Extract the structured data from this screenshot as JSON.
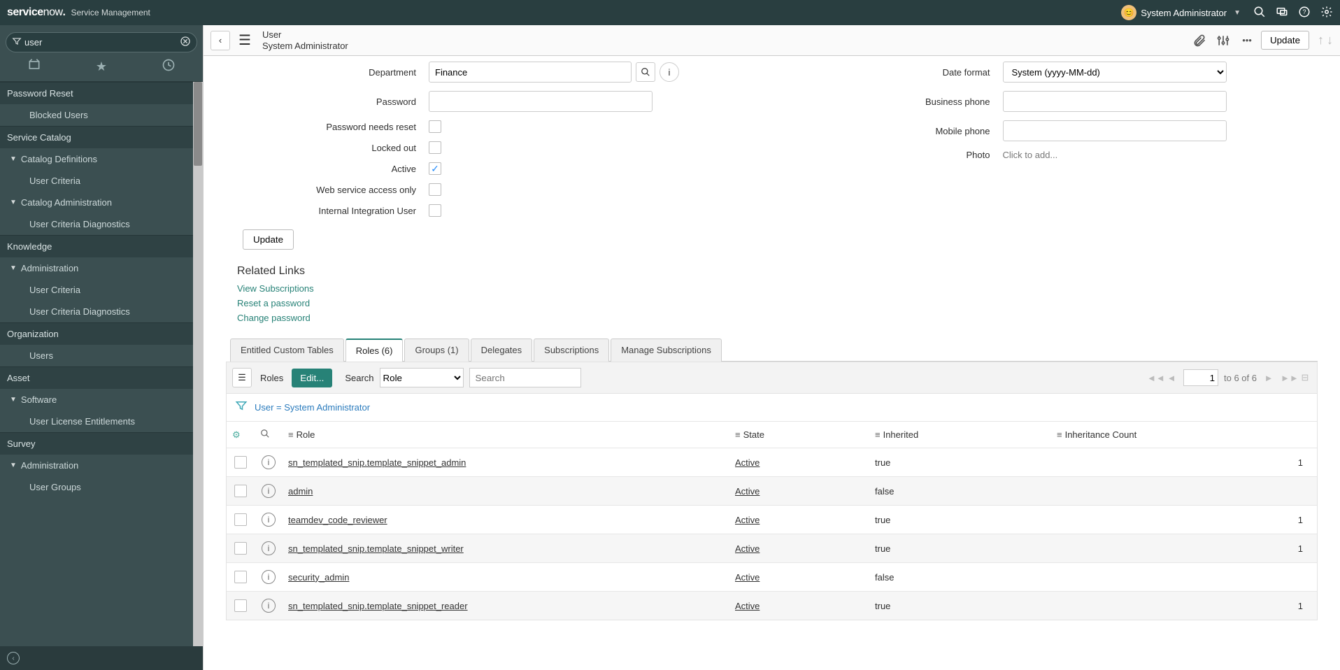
{
  "banner": {
    "logo_main": "service",
    "logo_suffix": "now",
    "product": "Service Management",
    "user_name": "System Administrator",
    "avatar_initials": "😊"
  },
  "nav": {
    "filter_value": "user",
    "sections": [
      {
        "type": "section",
        "label": "Password Reset"
      },
      {
        "type": "sub2",
        "label": "Blocked Users"
      },
      {
        "type": "section",
        "label": "Service Catalog"
      },
      {
        "type": "sub",
        "label": "Catalog Definitions",
        "tri": true
      },
      {
        "type": "sub2",
        "label": "User Criteria"
      },
      {
        "type": "sub",
        "label": "Catalog Administration",
        "tri": true
      },
      {
        "type": "sub2",
        "label": "User Criteria Diagnostics"
      },
      {
        "type": "section",
        "label": "Knowledge"
      },
      {
        "type": "sub",
        "label": "Administration",
        "tri": true
      },
      {
        "type": "sub2",
        "label": "User Criteria"
      },
      {
        "type": "sub2",
        "label": "User Criteria Diagnostics"
      },
      {
        "type": "section",
        "label": "Organization"
      },
      {
        "type": "sub2",
        "label": "Users"
      },
      {
        "type": "section",
        "label": "Asset"
      },
      {
        "type": "sub",
        "label": "Software",
        "tri": true
      },
      {
        "type": "sub2",
        "label": "User License Entitlements"
      },
      {
        "type": "section",
        "label": "Survey"
      },
      {
        "type": "sub",
        "label": "Administration",
        "tri": true
      },
      {
        "type": "sub2",
        "label": "User Groups"
      }
    ]
  },
  "header": {
    "title": "User",
    "subtitle": "System Administrator",
    "update_label": "Update"
  },
  "form": {
    "left": {
      "department_label": "Department",
      "department_value": "Finance",
      "password_label": "Password",
      "needs_reset_label": "Password needs reset",
      "locked_out_label": "Locked out",
      "active_label": "Active",
      "active_checked": "✓",
      "web_access_label": "Web service access only",
      "internal_label": "Internal Integration User"
    },
    "right": {
      "date_format_label": "Date format",
      "date_format_value": "System (yyyy-MM-dd)",
      "business_phone_label": "Business phone",
      "mobile_phone_label": "Mobile phone",
      "photo_label": "Photo",
      "photo_value": "Click to add..."
    },
    "update2": "Update"
  },
  "related": {
    "title": "Related Links",
    "links": [
      "View Subscriptions",
      "Reset a password",
      "Change password"
    ]
  },
  "tabs": [
    "Entitled Custom Tables",
    "Roles (6)",
    "Groups (1)",
    "Delegates",
    "Subscriptions",
    "Manage Subscriptions"
  ],
  "list": {
    "roles_label": "Roles",
    "edit_label": "Edit...",
    "search_label": "Search",
    "search_field": "Role",
    "search_placeholder": "Search",
    "breadcrumb": "User = System Administrator",
    "page_current": "1",
    "page_info": "to 6 of 6",
    "columns": {
      "role": "Role",
      "state": "State",
      "inherited": "Inherited",
      "count": "Inheritance Count"
    },
    "rows": [
      {
        "role": "sn_templated_snip.template_snippet_admin",
        "state": "Active",
        "inherited": "true",
        "count": "1"
      },
      {
        "role": "admin",
        "state": "Active",
        "inherited": "false",
        "count": ""
      },
      {
        "role": "teamdev_code_reviewer",
        "state": "Active",
        "inherited": "true",
        "count": "1"
      },
      {
        "role": "sn_templated_snip.template_snippet_writer",
        "state": "Active",
        "inherited": "true",
        "count": "1"
      },
      {
        "role": "security_admin",
        "state": "Active",
        "inherited": "false",
        "count": ""
      },
      {
        "role": "sn_templated_snip.template_snippet_reader",
        "state": "Active",
        "inherited": "true",
        "count": "1"
      }
    ],
    "page_info_bottom": "to 6 of 6"
  }
}
